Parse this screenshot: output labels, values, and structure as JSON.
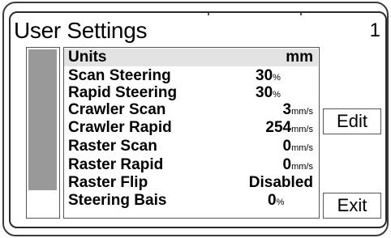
{
  "header": {
    "title": "User Settings",
    "page_number": "1"
  },
  "settings": [
    {
      "label": "Units",
      "value": "mm",
      "unit": ""
    },
    {
      "label": "Scan Steering",
      "value": "30",
      "unit": "%"
    },
    {
      "label": "Rapid Steering",
      "value": "30",
      "unit": "%"
    },
    {
      "label": "Crawler Scan",
      "value": "3",
      "unit": "mm/s"
    },
    {
      "label": "Crawler Rapid",
      "value": "254",
      "unit": "mm/s"
    },
    {
      "label": "Raster Scan",
      "value": "0",
      "unit": "mm/s"
    },
    {
      "label": "Raster Rapid",
      "value": "0",
      "unit": "mm/s"
    },
    {
      "label": "Raster Flip",
      "value": "Disabled",
      "unit": ""
    },
    {
      "label": "Steering Bais",
      "value": "0",
      "unit": "%"
    }
  ],
  "buttons": {
    "edit_label": "Edit",
    "exit_label": "Exit"
  },
  "colors": {
    "selected_row": "#e3e3e3",
    "scroll_thumb": "#999999",
    "frame": "#3a3a3a"
  }
}
